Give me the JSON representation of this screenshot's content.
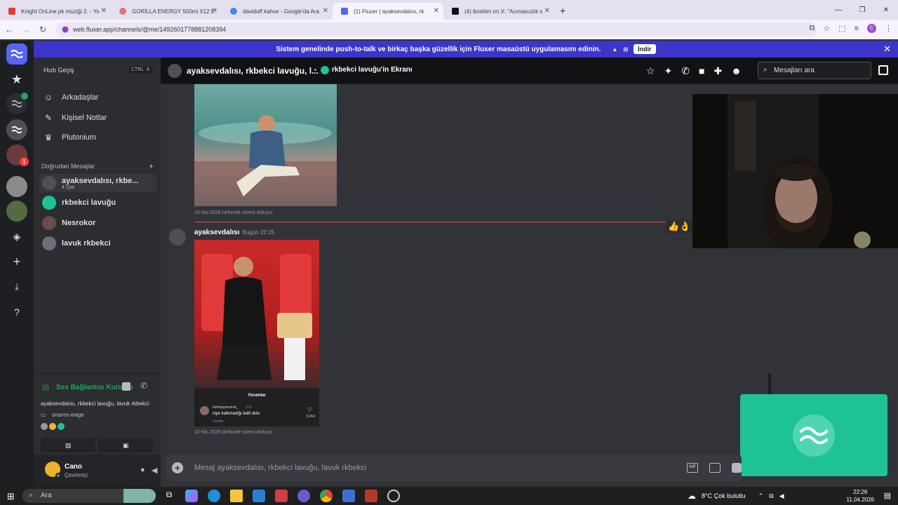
{
  "browser": {
    "tabs": [
      {
        "title": "Knight OnLine pk müziği 2. - Yo",
        "color": "#e53935"
      },
      {
        "title": "GORİLLA ENERGY 500ml X12 E",
        "color": "#e57373"
      },
      {
        "title": "davidoff kahve - Google'da Ara",
        "color": "#4285f4"
      },
      {
        "title": "(1) Fluxer | ayaksevdalısı, rk",
        "color": "#5865f2"
      },
      {
        "title": "(4) ibrahim on X: \"Acımasızlık s",
        "color": "#111111"
      }
    ],
    "url": "web.fluxer.app/channels/@me/1492601778881208394",
    "profile_initial": "C"
  },
  "banner": {
    "text": "Sistem genelinde push-to-talk ve birkaç başka güzellik için Fluxer masaüstü uygulamasını edinin.",
    "button": "İndir"
  },
  "sidebar": {
    "quick_switch": "Hızlı Geçiş",
    "kbd": [
      "CTRL",
      "K"
    ],
    "nav": [
      {
        "label": "Arkadaşlar",
        "icon": "friends-icon"
      },
      {
        "label": "Kişisel Notlar",
        "icon": "notes-icon"
      },
      {
        "label": "Plutonium",
        "icon": "crown-icon"
      }
    ],
    "dm_header": "Doğrudan Mesajlar",
    "dms": [
      {
        "name": "ayaksevdalısı, rkbe...",
        "sub": "4 Üye"
      },
      {
        "name": "rkbekci lavuğu",
        "sub": ""
      },
      {
        "name": "Nesrokor",
        "sub": ""
      },
      {
        "name": "lavuk rkbekci",
        "sub": ""
      }
    ],
    "voice": {
      "status": "Ses Bağlantısı Kuruldu",
      "channel": "ayaksevdalısı, rkbekci lavuğu, lavuk rkbekci",
      "device": "snares-wage"
    },
    "user": {
      "name": "Cano",
      "status": "Çevrimiçi"
    }
  },
  "chat": {
    "title": "ayaksevdalısı, rkbekci lavuğu, l...",
    "screen_share": "rkbekci lavuğu'in Ekranı",
    "search_placeholder": "Mesajları ara",
    "expiry_1": "10 Nis 2029 tarihinde süresi doluyor",
    "author": "ayaksevdalısı",
    "time": "Bugün 22:25",
    "caption": {
      "header": "Yorumlar",
      "user": "letithappenamk_",
      "age": "21s",
      "text": "niye kalkmadığı belli oldu",
      "reply": "Yanıtla",
      "likes": "9.454"
    },
    "expiry_2": "10 Nis 2029 tarihinde süresi doluyor",
    "composer_placeholder": "Mesaj ayaksevdalısı, rkbekci lavuğu, lavuk rkbekci",
    "gif_label": "GIF"
  },
  "rail_badge": "1",
  "taskbar": {
    "search": "Ara",
    "weather": "8°C  Çok bulutlu",
    "time": "22:26",
    "date": "11.04.2026"
  },
  "colors": {
    "accent": "#5865f2",
    "brand": "#1fc295",
    "online": "#23a55a",
    "banner": "#3b36c9"
  }
}
